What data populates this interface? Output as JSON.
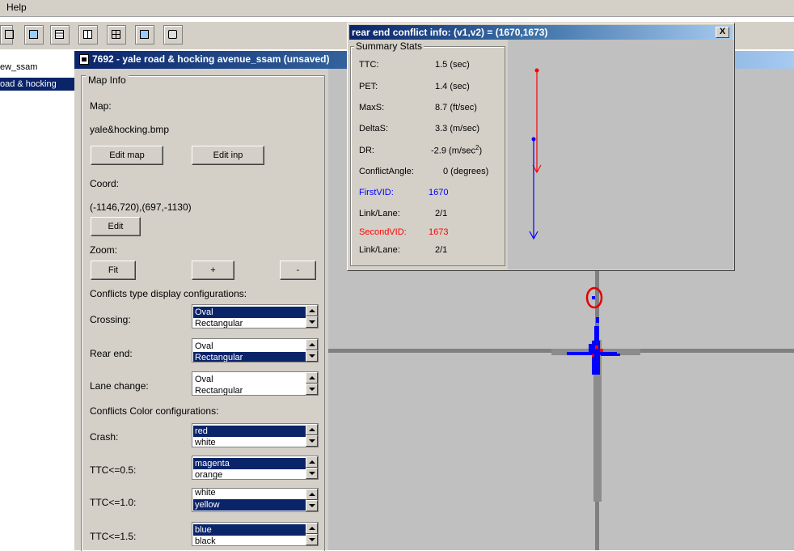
{
  "menubar": {
    "help_label": "Help"
  },
  "tree": {
    "items": [
      {
        "label": "ew_ssam",
        "selected": false
      },
      {
        "label": "oad & hocking",
        "selected": true
      }
    ]
  },
  "inner_window": {
    "title": "7692 - yale road & hocking avenue_ssam (unsaved)"
  },
  "map_info": {
    "legend": "Map Info",
    "map_label": "Map:",
    "map_file": "yale&hocking.bmp",
    "edit_map_btn": "Edit map",
    "edit_inp_btn": "Edit inp",
    "coord_label": "Coord:",
    "coord_value": "(-1146,720),(697,-1130)",
    "edit_btn": "Edit",
    "zoom_label": "Zoom:",
    "fit_btn": "Fit",
    "zoom_in_btn": "+",
    "zoom_out_btn": "-",
    "conflicts_type_heading": "Conflicts type display configurations:",
    "crossing_label": "Crossing:",
    "crossing_options": [
      "Oval",
      "Rectangular"
    ],
    "crossing_selected": "Oval",
    "rear_end_label": "Rear end:",
    "rear_end_options": [
      "Oval",
      "Rectangular"
    ],
    "rear_end_selected": "Rectangular",
    "lane_change_label": "Lane change:",
    "lane_change_options": [
      "Oval",
      "Rectangular"
    ],
    "conflicts_color_heading": "Conflicts Color configurations:",
    "crash_label": "Crash:",
    "crash_options": [
      "red",
      "white"
    ],
    "crash_selected": "red",
    "ttc05_label": "TTC<=0.5:",
    "ttc05_options": [
      "magenta",
      "orange"
    ],
    "ttc05_selected": "magenta",
    "ttc10_label": "TTC<=1.0:",
    "ttc10_options": [
      "white",
      "yellow"
    ],
    "ttc10_selected": "yellow",
    "ttc15_label": "TTC<=1.5:",
    "ttc15_options": [
      "blue",
      "black"
    ],
    "ttc15_selected": "blue"
  },
  "popup": {
    "title": "rear end conflict info: (v1,v2) = (1670,1673)",
    "close": "X",
    "summary_legend": "Summary Stats",
    "stats": [
      {
        "label": "TTC:",
        "value": "1.5 (sec)"
      },
      {
        "label": "PET:",
        "value": "1.4 (sec)"
      },
      {
        "label": "MaxS:",
        "value": "8.7 (ft/sec)"
      },
      {
        "label": "DeltaS:",
        "value": "3.3 (m/sec)"
      },
      {
        "label": "DR:",
        "value": "-2.9",
        "unit": "(m/sec",
        "sup": "2",
        "close": ")"
      },
      {
        "label": "ConflictAngle:",
        "value": "0 (degrees)"
      }
    ],
    "first_vid_label": "FirstVID:",
    "first_vid": "1670",
    "first_link_label": "Link/Lane:",
    "first_link": "2/1",
    "second_vid_label": "SecondVID:",
    "second_vid": "1673",
    "second_link_label": "Link/Lane:",
    "second_link": "2/1"
  },
  "colors": {
    "first_vehicle": "#0000ff",
    "second_vehicle": "#ff0000",
    "selection": "#0a246a",
    "road": "#808080",
    "map_bg": "#c0c0c0"
  }
}
